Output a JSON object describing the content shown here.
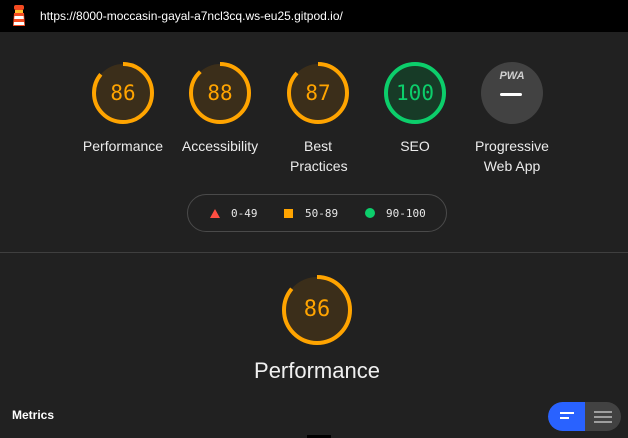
{
  "browser": {
    "url": "https://8000-moccasin-gayal-a7ncl3cq.ws-eu25.gitpod.io/"
  },
  "colors": {
    "fail": "#ff4e42",
    "average": "#ffa400",
    "pass": "#0cce6b",
    "pwa": "#424242",
    "toggle_active": "#2962ff"
  },
  "categories": [
    {
      "score": "86",
      "label": "Performance",
      "status": "average"
    },
    {
      "score": "88",
      "label": "Accessibility",
      "status": "average"
    },
    {
      "score": "87",
      "label": "Best Practices",
      "status": "average"
    },
    {
      "score": "100",
      "label": "SEO",
      "status": "pass"
    },
    {
      "score": "",
      "label": "Progressive Web App",
      "badge": "PWA",
      "status": "pwa"
    }
  ],
  "legend": {
    "fail": "0-49",
    "average": "50-89",
    "pass": "90-100"
  },
  "section": {
    "score": "86",
    "title": "Performance"
  },
  "metrics": {
    "heading": "Metrics",
    "toggle_icons": [
      "compact-view-icon",
      "expanded-view-icon"
    ]
  }
}
